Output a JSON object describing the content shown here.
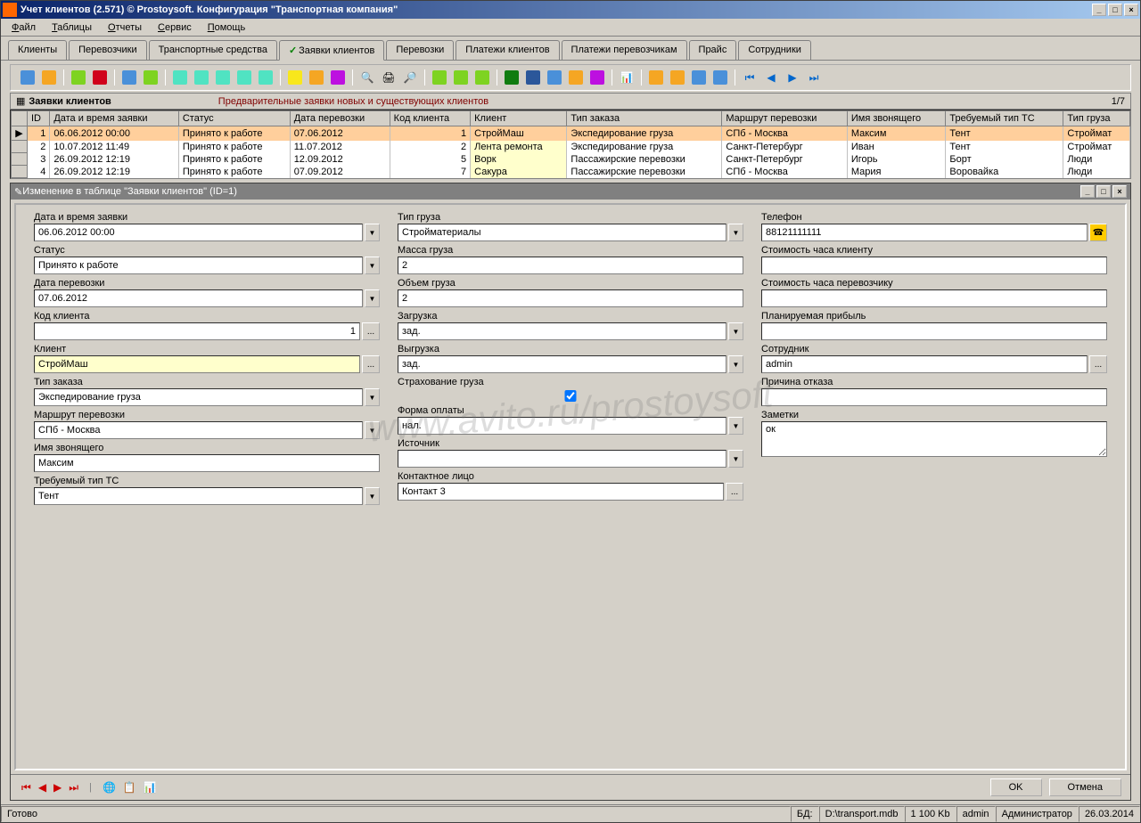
{
  "window": {
    "title": "Учет клиентов (2.571) © Prostoysoft. Конфигурация \"Транспортная компания\""
  },
  "menu": [
    "Файл",
    "Таблицы",
    "Отчеты",
    "Сервис",
    "Помощь"
  ],
  "tabs": [
    "Клиенты",
    "Перевозчики",
    "Транспортные средства",
    "Заявки клиентов",
    "Перевозки",
    "Платежи клиентов",
    "Платежи перевозчикам",
    "Прайс",
    "Сотрудники"
  ],
  "active_tab": 3,
  "grid_header": {
    "title": "Заявки клиентов",
    "desc": "Предварительные заявки новых и существующих клиентов",
    "count": "1/7"
  },
  "columns": [
    "ID",
    "Дата и время заявки",
    "Статус",
    "Дата перевозки",
    "Код клиента",
    "Клиент",
    "Тип заказа",
    "Маршрут перевозки",
    "Имя звонящего",
    "Требуемый тип ТС",
    "Тип груза"
  ],
  "rows": [
    {
      "id": "1",
      "dt": "06.06.2012 00:00",
      "status": "Принято к работе",
      "date": "07.06.2012",
      "code": "1",
      "client": "СтройМаш",
      "type": "Экспедирование груза",
      "route": "СПб - Москва",
      "caller": "Максим",
      "ts": "Тент",
      "cargo": "Строймат"
    },
    {
      "id": "2",
      "dt": "10.07.2012 11:49",
      "status": "Принято к работе",
      "date": "11.07.2012",
      "code": "2",
      "client": "Лента ремонта",
      "type": "Экспедирование груза",
      "route": "Санкт-Петербург",
      "caller": "Иван",
      "ts": "Тент",
      "cargo": "Строймат"
    },
    {
      "id": "3",
      "dt": "26.09.2012 12:19",
      "status": "Принято к работе",
      "date": "12.09.2012",
      "code": "5",
      "client": "Ворк",
      "type": "Пассажирские перевозки",
      "route": "Санкт-Петербург",
      "caller": "Игорь",
      "ts": "Борт",
      "cargo": "Люди"
    },
    {
      "id": "4",
      "dt": "26.09.2012 12:19",
      "status": "Принято к работе",
      "date": "07.09.2012",
      "code": "7",
      "client": "Сакура",
      "type": "Пассажирские перевозки",
      "route": "СПб - Москва",
      "caller": "Мария",
      "ts": "Воровайка",
      "cargo": "Люди"
    }
  ],
  "subwindow": {
    "title": "Изменение в таблице \"Заявки клиентов\" (ID=1)"
  },
  "form": {
    "col1": {
      "date_request_label": "Дата и время заявки",
      "date_request": "06.06.2012 00:00",
      "status_label": "Статус",
      "status": "Принято к работе",
      "date_transport_label": "Дата перевозки",
      "date_transport": "07.06.2012",
      "client_code_label": "Код клиента",
      "client_code": "1",
      "client_label": "Клиент",
      "client": "СтройМаш",
      "order_type_label": "Тип заказа",
      "order_type": "Экспедирование груза",
      "route_label": "Маршрут перевозки",
      "route": "СПб - Москва",
      "caller_label": "Имя звонящего",
      "caller": "Максим",
      "ts_type_label": "Требуемый тип ТС",
      "ts_type": "Тент"
    },
    "col2": {
      "cargo_type_label": "Тип груза",
      "cargo_type": "Стройматериалы",
      "mass_label": "Масса груза",
      "mass": "2",
      "volume_label": "Объем груза",
      "volume": "2",
      "load_label": "Загрузка",
      "load": "зад.",
      "unload_label": "Выгрузка",
      "unload": "зад.",
      "insurance_label": "Страхование груза",
      "payment_label": "Форма оплаты",
      "payment": "нал.",
      "source_label": "Источник",
      "source": "",
      "contact_label": "Контактное лицо",
      "contact": "Контакт 3"
    },
    "col3": {
      "phone_label": "Телефон",
      "phone": "88121111111",
      "cost_client_label": "Стоимость часа клиенту",
      "cost_client": "",
      "cost_carrier_label": "Стоимость часа перевозчику",
      "cost_carrier": "",
      "profit_label": "Планируемая прибыль",
      "profit": "",
      "employee_label": "Сотрудник",
      "employee": "admin",
      "reject_label": "Причина отказа",
      "reject": "",
      "notes_label": "Заметки",
      "notes": "ок"
    }
  },
  "buttons": {
    "ok": "OK",
    "cancel": "Отмена"
  },
  "statusbar": {
    "ready": "Готово",
    "db_label": "БД:",
    "db": "D:\\transport.mdb",
    "size": "1 100 Kb",
    "user": "admin",
    "role": "Администратор",
    "date": "26.03.2014"
  },
  "watermark": "www.avito.ru/prostoysoft"
}
